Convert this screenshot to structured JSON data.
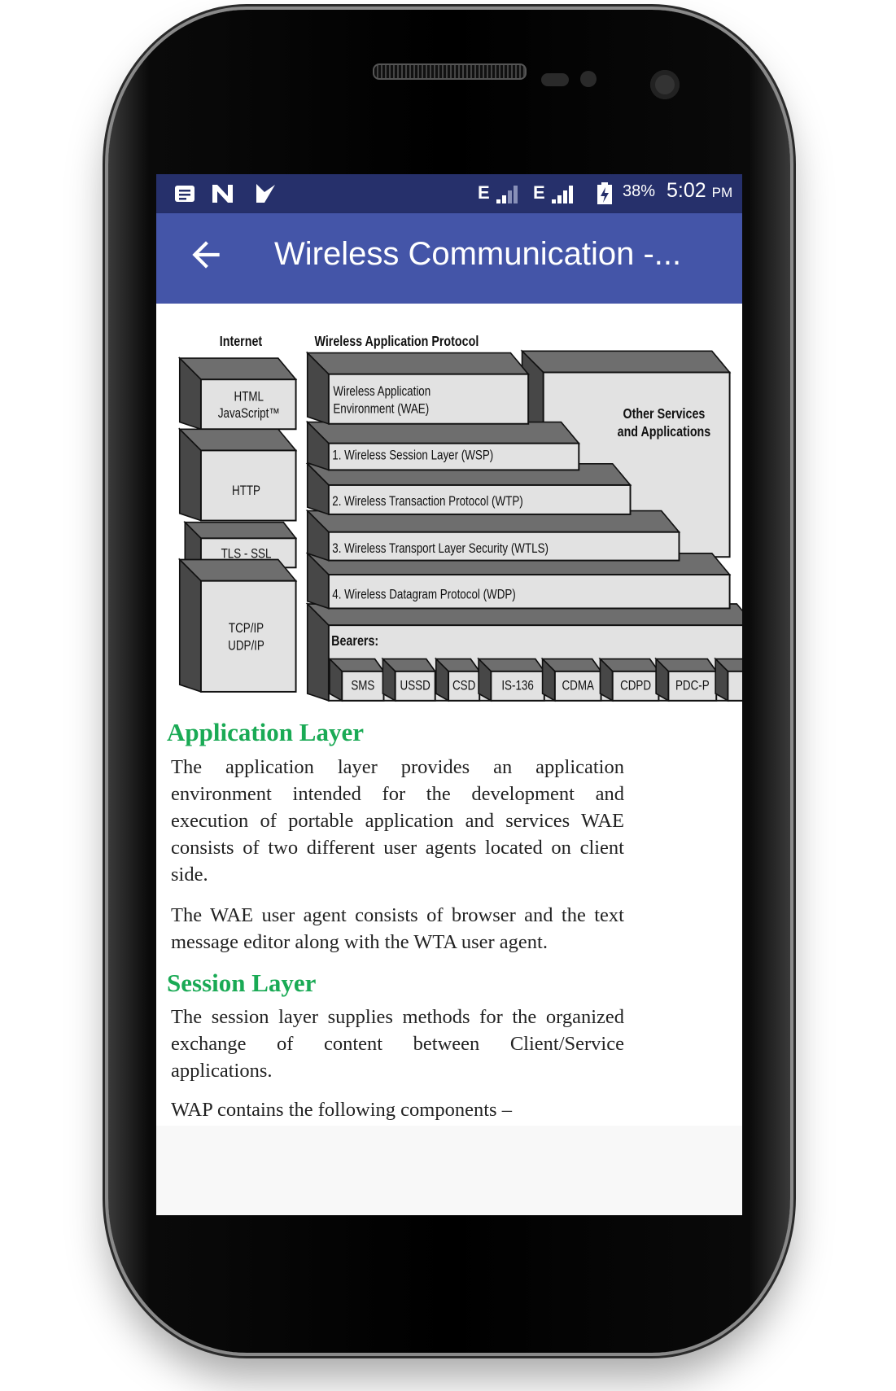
{
  "status_bar": {
    "left_icons": [
      "notes-icon",
      "n-app-icon",
      "check-app-icon"
    ],
    "network1": "E",
    "network2": "E",
    "battery": "38%",
    "time": "5:02",
    "ampm": "PM"
  },
  "app_bar": {
    "title": "Wireless Communication -...",
    "back_icon": "arrow-left-icon",
    "color": "#4455a8"
  },
  "diagram": {
    "internet_label": "Internet",
    "wap_label": "Wireless Application Protocol",
    "internet_stack": [
      "HTML",
      "JavaScript™",
      "HTTP",
      "TLS - SSL",
      "TCP/IP",
      "UDP/IP"
    ],
    "wae": [
      "Wireless Application",
      "Environment (WAE)"
    ],
    "layers": [
      "1. Wireless Session Layer (WSP)",
      "2. Wireless Transaction Protocol (WTP)",
      "3. Wireless Transport Layer Security (WTLS)",
      "4. Wireless Datagram Protocol (WDP)"
    ],
    "other": [
      "Other Services",
      "and Applications"
    ],
    "bearers_label": "Bearers:",
    "bearers": [
      "SMS",
      "USSD",
      "CSD",
      "IS-136",
      "CDMA",
      "CDPD",
      "PDC-P"
    ]
  },
  "article": {
    "heading_color": "#1aaa55",
    "sections": [
      {
        "heading": "Application Layer",
        "paragraphs": [
          "The application layer provides an application environment intended for the development and execution of portable application and services WAE consists of two different user agents located on client side.",
          "The WAE user agent consists of browser and the text message editor along with the WTA user agent."
        ]
      },
      {
        "heading": "Session Layer",
        "paragraphs": [
          "The session layer supplies methods for the organized exchange of content between Client/Service applications.",
          "WAP contains the following components –"
        ]
      }
    ]
  }
}
